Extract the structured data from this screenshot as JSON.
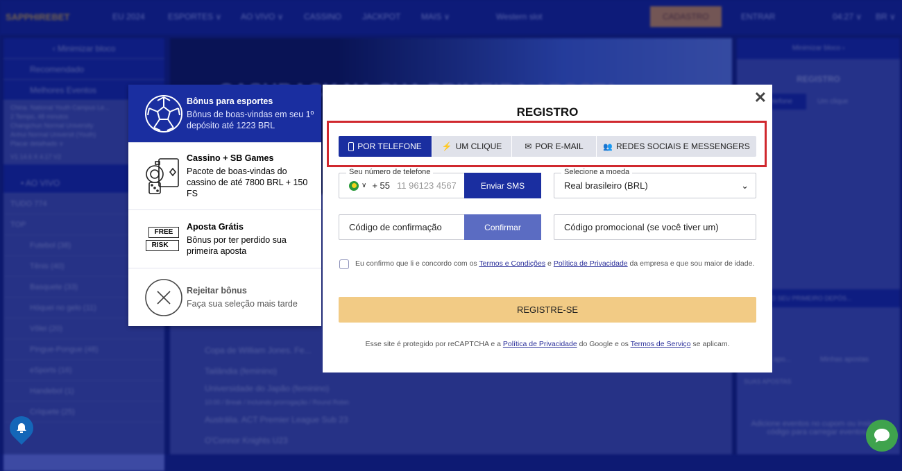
{
  "header": {
    "logo": "SAPPHIREBET",
    "nav": [
      "EU 2024",
      "ESPORTES ∨",
      "AO VIVO ∨",
      "CASSINO",
      "JACKPOT",
      "MAIS ∨",
      "Western slot"
    ],
    "cadastro": "CADASTRO",
    "entrar": "ENTRAR",
    "time": "04:27 ∨",
    "lang": "BR ∨"
  },
  "left": {
    "minimize": "‹ Minimizar bloco",
    "items": [
      "Recomendado",
      "Melhores Eventos"
    ],
    "match": [
      "China. National Youth Campus Le...",
      "2 Tempo, 48 minutos",
      "Changchun Normal University",
      "Anhui Normal Universit (Youth)",
      "Placar detalhado ∨"
    ],
    "odds": "V1   14.6   X   4.17   V2",
    "live_tabs": [
      "• AO VIVO",
      "ESPORTES"
    ],
    "all": "TUDO 774",
    "top": "TOP",
    "sports": [
      "Futebol (38)",
      "Tênis (40)",
      "Basquete (33)",
      "Hóquei no gelo (11)",
      "Vôlei (20)",
      "Pingue-Pongue (48)",
      "eSports (16)",
      "Handebol (1)",
      "Críquete (25)"
    ]
  },
  "center": {
    "banner": "CASHBACK NA SUA PRIMEIRA APOSTA",
    "rows": [
      "Copa de William Jones. Fe...",
      "Tailândia (feminino)",
      "Universidade do Japão (feminino)",
      "10:00 / Break / Incluindo prorrogação / Round Robin",
      "Austrália. ACT Premier League Sub 23",
      "O'Connor Knights U23"
    ]
  },
  "right": {
    "minimize": "Minimizar bloco ›",
    "title": "REGISTRO",
    "tabs": [
      "Por telefone",
      "Um clique"
    ],
    "promo": "BÔNUS NO SEU PRIMEIRO DEPÓS...",
    "bet_tabs": [
      "Cupom de apo...",
      "Minhas apostas"
    ],
    "your_bets": "SUAS APOSTAS",
    "empty": "Adicione eventos no cupom ou insira o código para carregar eventos"
  },
  "bonus": [
    {
      "title": "Bônus para esportes",
      "desc": "Bônus de boas-vindas em seu 1º depósito até 1223 BRL",
      "icon": "soccer-ball-icon",
      "active": true
    },
    {
      "title": "Cassino + SB Games",
      "desc": "Pacote de boas-vindas do cassino de até 7800 BRL + 150 FS",
      "icon": "casino-chips-cards-icon"
    },
    {
      "title": "Aposta Grátis",
      "desc": "Bônus por ter perdido sua primeira aposta",
      "icon": "free-risk-icon",
      "icon_text": [
        "FREE",
        "RISK"
      ]
    },
    {
      "title": "Rejeitar bônus",
      "desc": "Faça sua seleção mais tarde",
      "icon": "reject-x-icon"
    }
  ],
  "modal": {
    "title": "REGISTRO",
    "tabs": [
      {
        "label": "POR TELEFONE",
        "icon": "phone-icon"
      },
      {
        "label": "UM CLIQUE",
        "icon": "lightning-icon"
      },
      {
        "label": "POR E-MAIL",
        "icon": "envelope-icon"
      },
      {
        "label": "REDES SOCIAIS E MESSENGERS",
        "icon": "users-icon"
      }
    ],
    "phone": {
      "label": "Seu número de telefone",
      "code": "+ 55",
      "placeholder": "11 96123 4567",
      "send": "Enviar SMS"
    },
    "currency": {
      "label": "Selecione a moeda",
      "value": "Real brasileiro (BRL)"
    },
    "code": {
      "placeholder": "Código de confirmação",
      "confirm": "Confirmar"
    },
    "promo": {
      "placeholder": "Código promocional (se você tiver um)"
    },
    "terms": {
      "pre": "Eu confirmo que li e concordo com os ",
      "link1": "Termos e Condições",
      "mid": " e ",
      "link2": "Política de Privacidade",
      "post": " da empresa e que sou maior de idade."
    },
    "submit": "REGISTRE-SE",
    "footer": {
      "pre": "Esse site é protegido por reCAPTCHA e a ",
      "link1": "Política de Privacidade",
      "mid": " do Google e os ",
      "link2": "Termos de Serviço",
      "post": " se aplicam."
    }
  },
  "colors": {
    "accent": "#1a2ea0",
    "highlight": "#d0282e",
    "submit": "#f2cb85"
  }
}
